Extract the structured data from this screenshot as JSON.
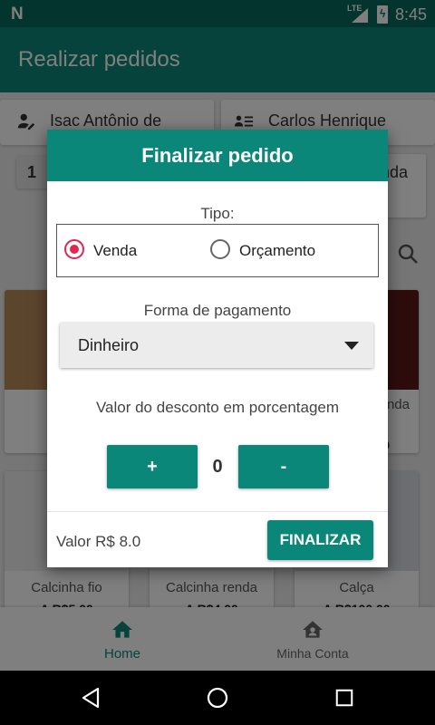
{
  "status_bar": {
    "logo": "N",
    "network": "LTE",
    "time": "8:45"
  },
  "app_bar": {
    "title": "Realizar pedidos"
  },
  "background": {
    "customer_name": "Isac Antônio de",
    "seller_name": "Carlos Henrique",
    "quantity": "1",
    "sale_type_fragment": "nda",
    "products": [
      {
        "name": "Calcin",
        "price": "A"
      },
      {
        "name": "enda",
        "price": "0"
      },
      {
        "name": "Calcinha fio",
        "price": "A R$5,00"
      },
      {
        "name": "Calcinha renda",
        "price": "A R$4,00"
      },
      {
        "name": "Calça",
        "price": "A R$100,00"
      }
    ]
  },
  "dialog": {
    "title": "Finalizar pedido",
    "tipo_label": "Tipo:",
    "options": [
      {
        "label": "Venda",
        "selected": true
      },
      {
        "label": "Orçamento",
        "selected": false
      }
    ],
    "payment_label": "Forma de pagamento",
    "payment_value": "Dinheiro",
    "discount_label": "Valor do desconto em porcentagem",
    "plus_label": "+",
    "minus_label": "-",
    "discount_value": "0",
    "total_label": "Valor R$ 8.0",
    "finish_label": "FINALIZAR"
  },
  "bottom_nav": {
    "items": [
      {
        "label": "Home",
        "active": true
      },
      {
        "label": "Minha Conta",
        "active": false
      }
    ]
  },
  "colors": {
    "primary": "#0a8778",
    "primary_dark": "#07695d",
    "accent": "#e3264f"
  }
}
